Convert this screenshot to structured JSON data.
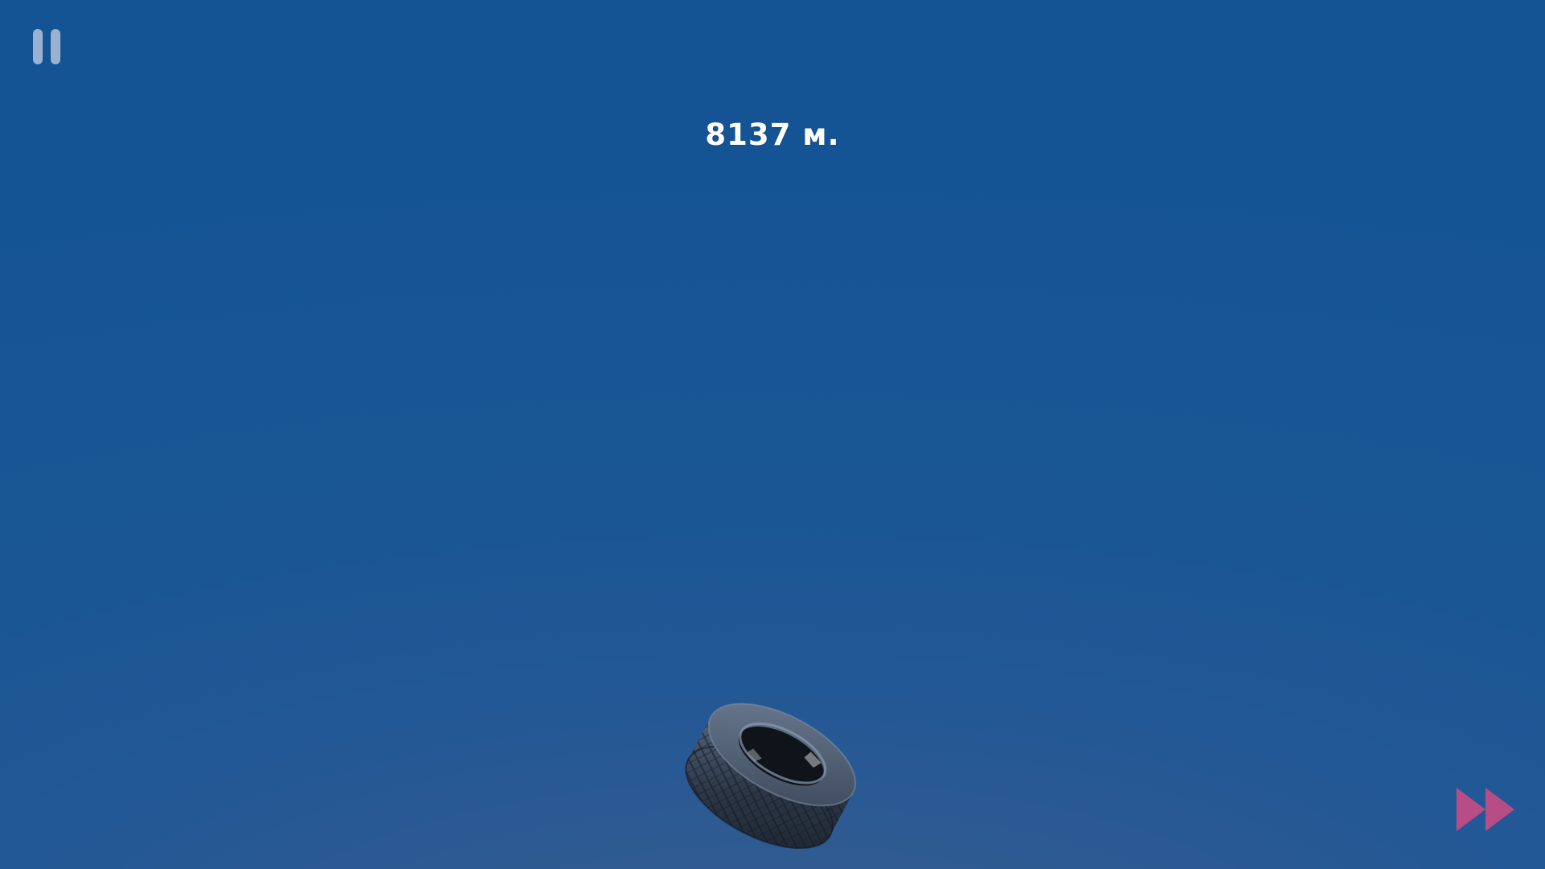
{
  "hud": {
    "distance_text": "8137 м.",
    "pause_icon": "pause-icon",
    "fast_forward_icon": "fast-forward-icon"
  },
  "scene": {
    "object": "tire",
    "sky_top_color": "#155494",
    "sky_bottom_color": "#3f5b8c"
  },
  "colors": {
    "pause_icon": "#a8bcd6",
    "fast_forward_icon": "#b84d86",
    "distance_text": "#ffffff"
  }
}
